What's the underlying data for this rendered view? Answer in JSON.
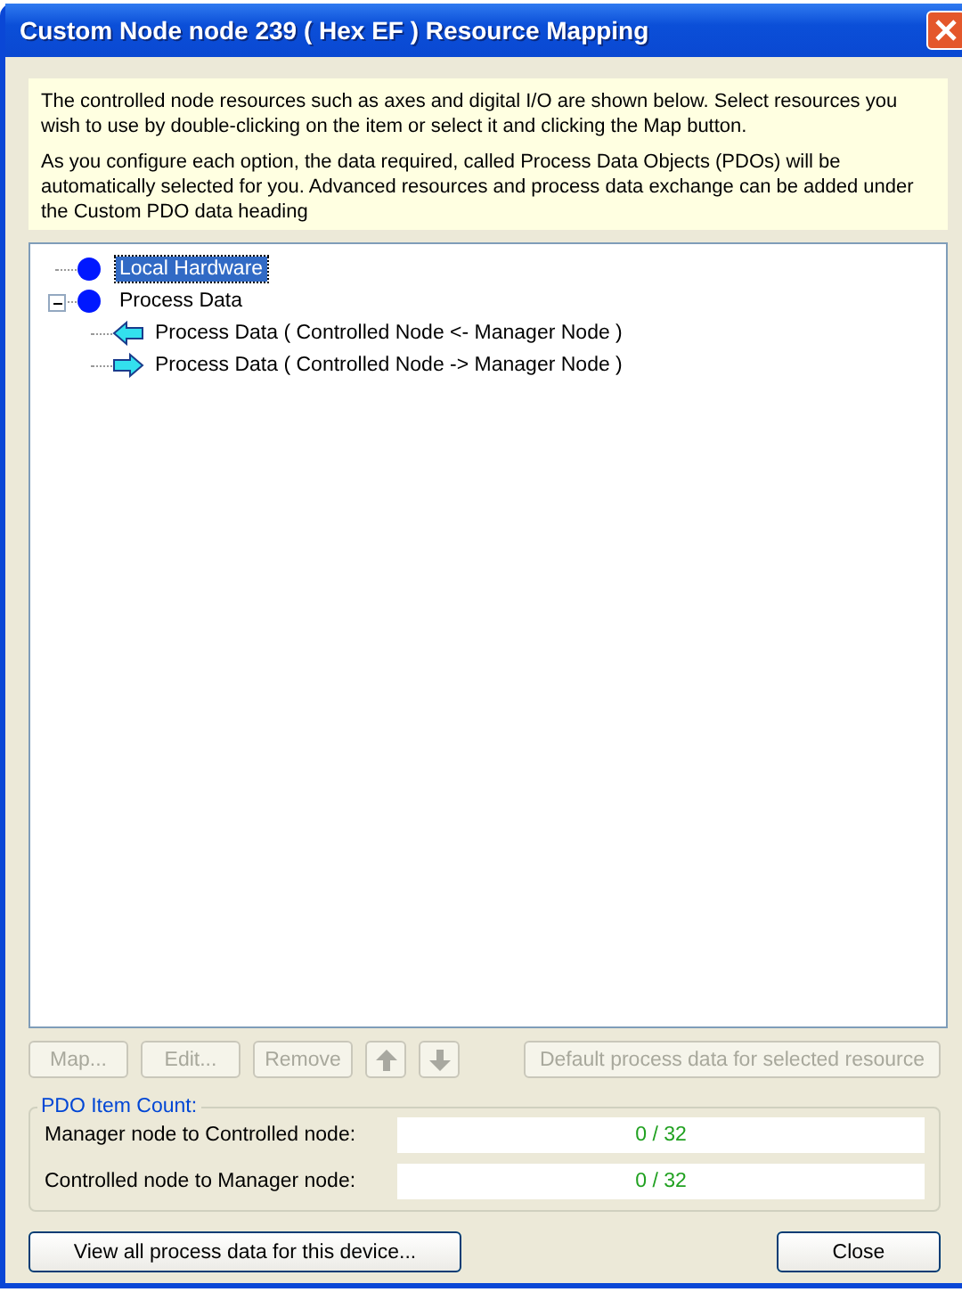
{
  "window": {
    "title": "Custom Node node 239 ( Hex EF ) Resource Mapping"
  },
  "info": [
    "The controlled node resources such as axes and digital I/O are shown below. Select resources you wish to use by double-clicking on the item or select it and clicking the Map button.",
    "As you configure each option, the data required, called Process Data Objects (PDOs) will be automatically selected for you. Advanced resources and process data exchange can be added under the Custom PDO data heading"
  ],
  "tree": [
    {
      "label": "Local Hardware",
      "kind": "node",
      "selected": true
    },
    {
      "label": "Process Data",
      "kind": "node",
      "selected": false,
      "expanded": true,
      "children": [
        {
          "label": "Process Data ( Controlled Node <- Manager Node )",
          "kind": "arrow-left",
          "selected": false
        },
        {
          "label": "Process Data ( Controlled Node -> Manager Node )",
          "kind": "arrow-right",
          "selected": false
        }
      ]
    }
  ],
  "actions": [
    {
      "kind": "text",
      "label": "Map...",
      "disabled": true
    },
    {
      "kind": "text",
      "label": "Edit...",
      "disabled": true
    },
    {
      "kind": "text",
      "label": "Remove",
      "disabled": true
    },
    {
      "kind": "up",
      "disabled": true
    },
    {
      "kind": "down",
      "disabled": true
    },
    {
      "kind": "text",
      "label": "Default process data for selected resource",
      "disabled": true
    }
  ],
  "pdo_count": {
    "title": "PDO Item Count:",
    "rows": [
      {
        "label": "Manager node to Controlled node:",
        "value": "0 / 32"
      },
      {
        "label": "Controlled node to Manager node:",
        "value": "0 / 32"
      }
    ]
  },
  "footer": {
    "view_button": "View all process data for this device...",
    "close_button": "Close"
  }
}
